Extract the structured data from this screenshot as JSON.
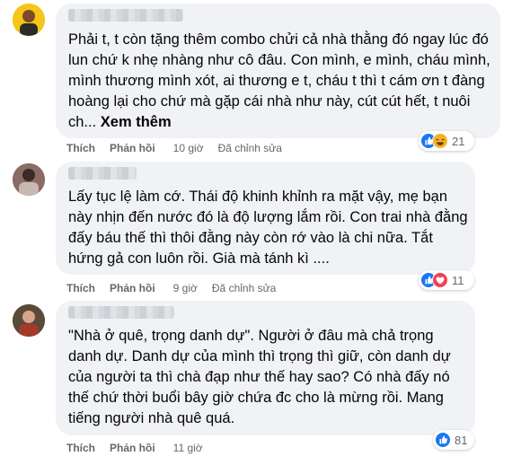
{
  "comments": [
    {
      "text": "Phải t, t còn tặng thêm combo chửi cả nhà thằng đó ngay lúc đó lun chứ k nhẹ nhàng như cô đâu. Con mình, e mình, cháu mình, mình thương mình xót, ai thương e t, cháu t thì t cám ơn t đàng hoàng lại cho chứ mà gặp cái nhà như này, cút cút hết, t nuôi ch...",
      "see_more": "Xem thêm",
      "like": "Thích",
      "reply": "Phản hồi",
      "time": "10 giờ",
      "edited": "Đã chỉnh sửa",
      "reaction_icons": [
        "like-icon",
        "haha-icon"
      ],
      "reaction_count": "21"
    },
    {
      "text": "Lấy tục lệ làm cớ. Thái độ khinh khỉnh ra mặt vậy, mẹ bạn này nhịn đến nước đó là độ lượng lắm rồi. Con trai nhà đằng đấy báu thế thì thôi đằng này còn rớ vào là chi nữa. Tắt hứng gả con luôn rồi. Già mà tánh kì ....",
      "like": "Thích",
      "reply": "Phản hồi",
      "time": "9 giờ",
      "edited": "Đã chỉnh sửa",
      "reaction_icons": [
        "like-icon",
        "love-icon"
      ],
      "reaction_count": "11"
    },
    {
      "text": "\"Nhà ở quê, trọng danh dự\". Người ở đâu mà chả trọng danh dự. Danh dự của mình thì trọng thì giữ, còn danh dự của người ta thì chà đạp như thế hay sao? Có nhà đấy nó thế chứ thời buổi bây giờ chứa đc cho là mừng rồi. Mang tiếng người nhà quê quá.",
      "like": "Thích",
      "reply": "Phản hồi",
      "time": "11 giờ",
      "reaction_icons": [
        "like-icon"
      ],
      "reaction_count": "81"
    }
  ],
  "colors": {
    "bubble": "#f0f2f5",
    "meta": "#65676b",
    "like": "#1877f2",
    "haha": "#f7b125",
    "love": "#f33e58"
  }
}
